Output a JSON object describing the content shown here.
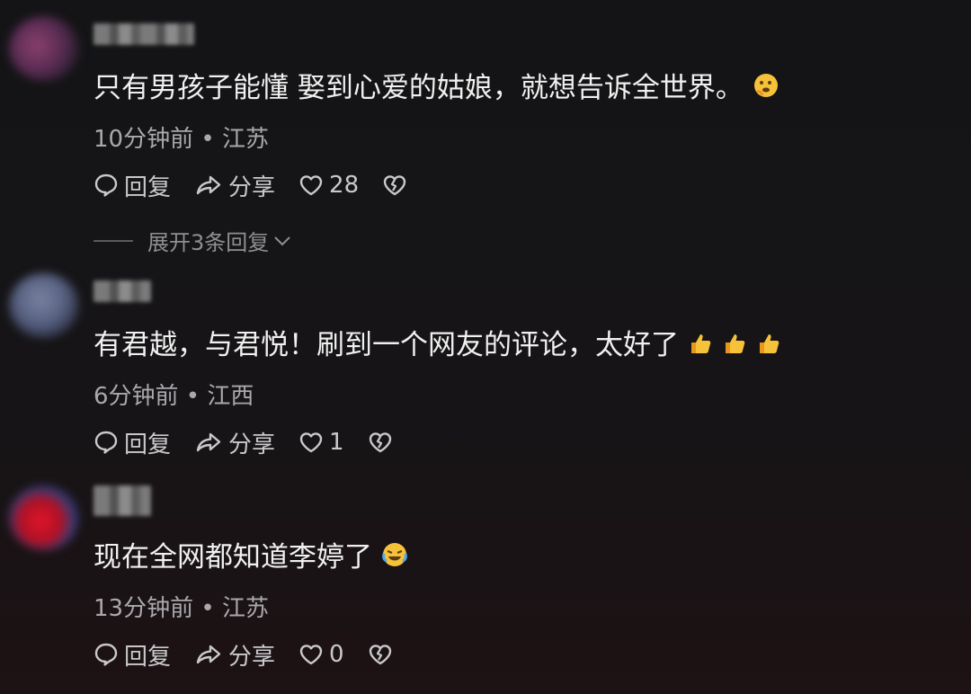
{
  "comments": [
    {
      "text": "只有男孩子能懂 娶到心爱的姑娘，就想告诉全世界。",
      "emoji": "thinking-face-icon",
      "time": "10分钟前",
      "location": "江苏",
      "reply_label": "回复",
      "share_label": "分享",
      "likes": "28",
      "expand_label": "展开3条回复"
    },
    {
      "text": "有君越，与君悦！刷到一个网友的评论，太好了",
      "emoji": "thumbs-up-icon x3",
      "time": "6分钟前",
      "location": "江西",
      "reply_label": "回复",
      "share_label": "分享",
      "likes": "1"
    },
    {
      "text": "现在全网都知道李婷了",
      "emoji": "crying-laughing-icon",
      "time": "13分钟前",
      "location": "江苏",
      "reply_label": "回复",
      "share_label": "分享",
      "likes": "0"
    }
  ],
  "colors": {
    "background": "#141416",
    "text": "#f0f0f0",
    "meta": "#a9a9ad",
    "emoji_yellow": "#f6c23a"
  }
}
